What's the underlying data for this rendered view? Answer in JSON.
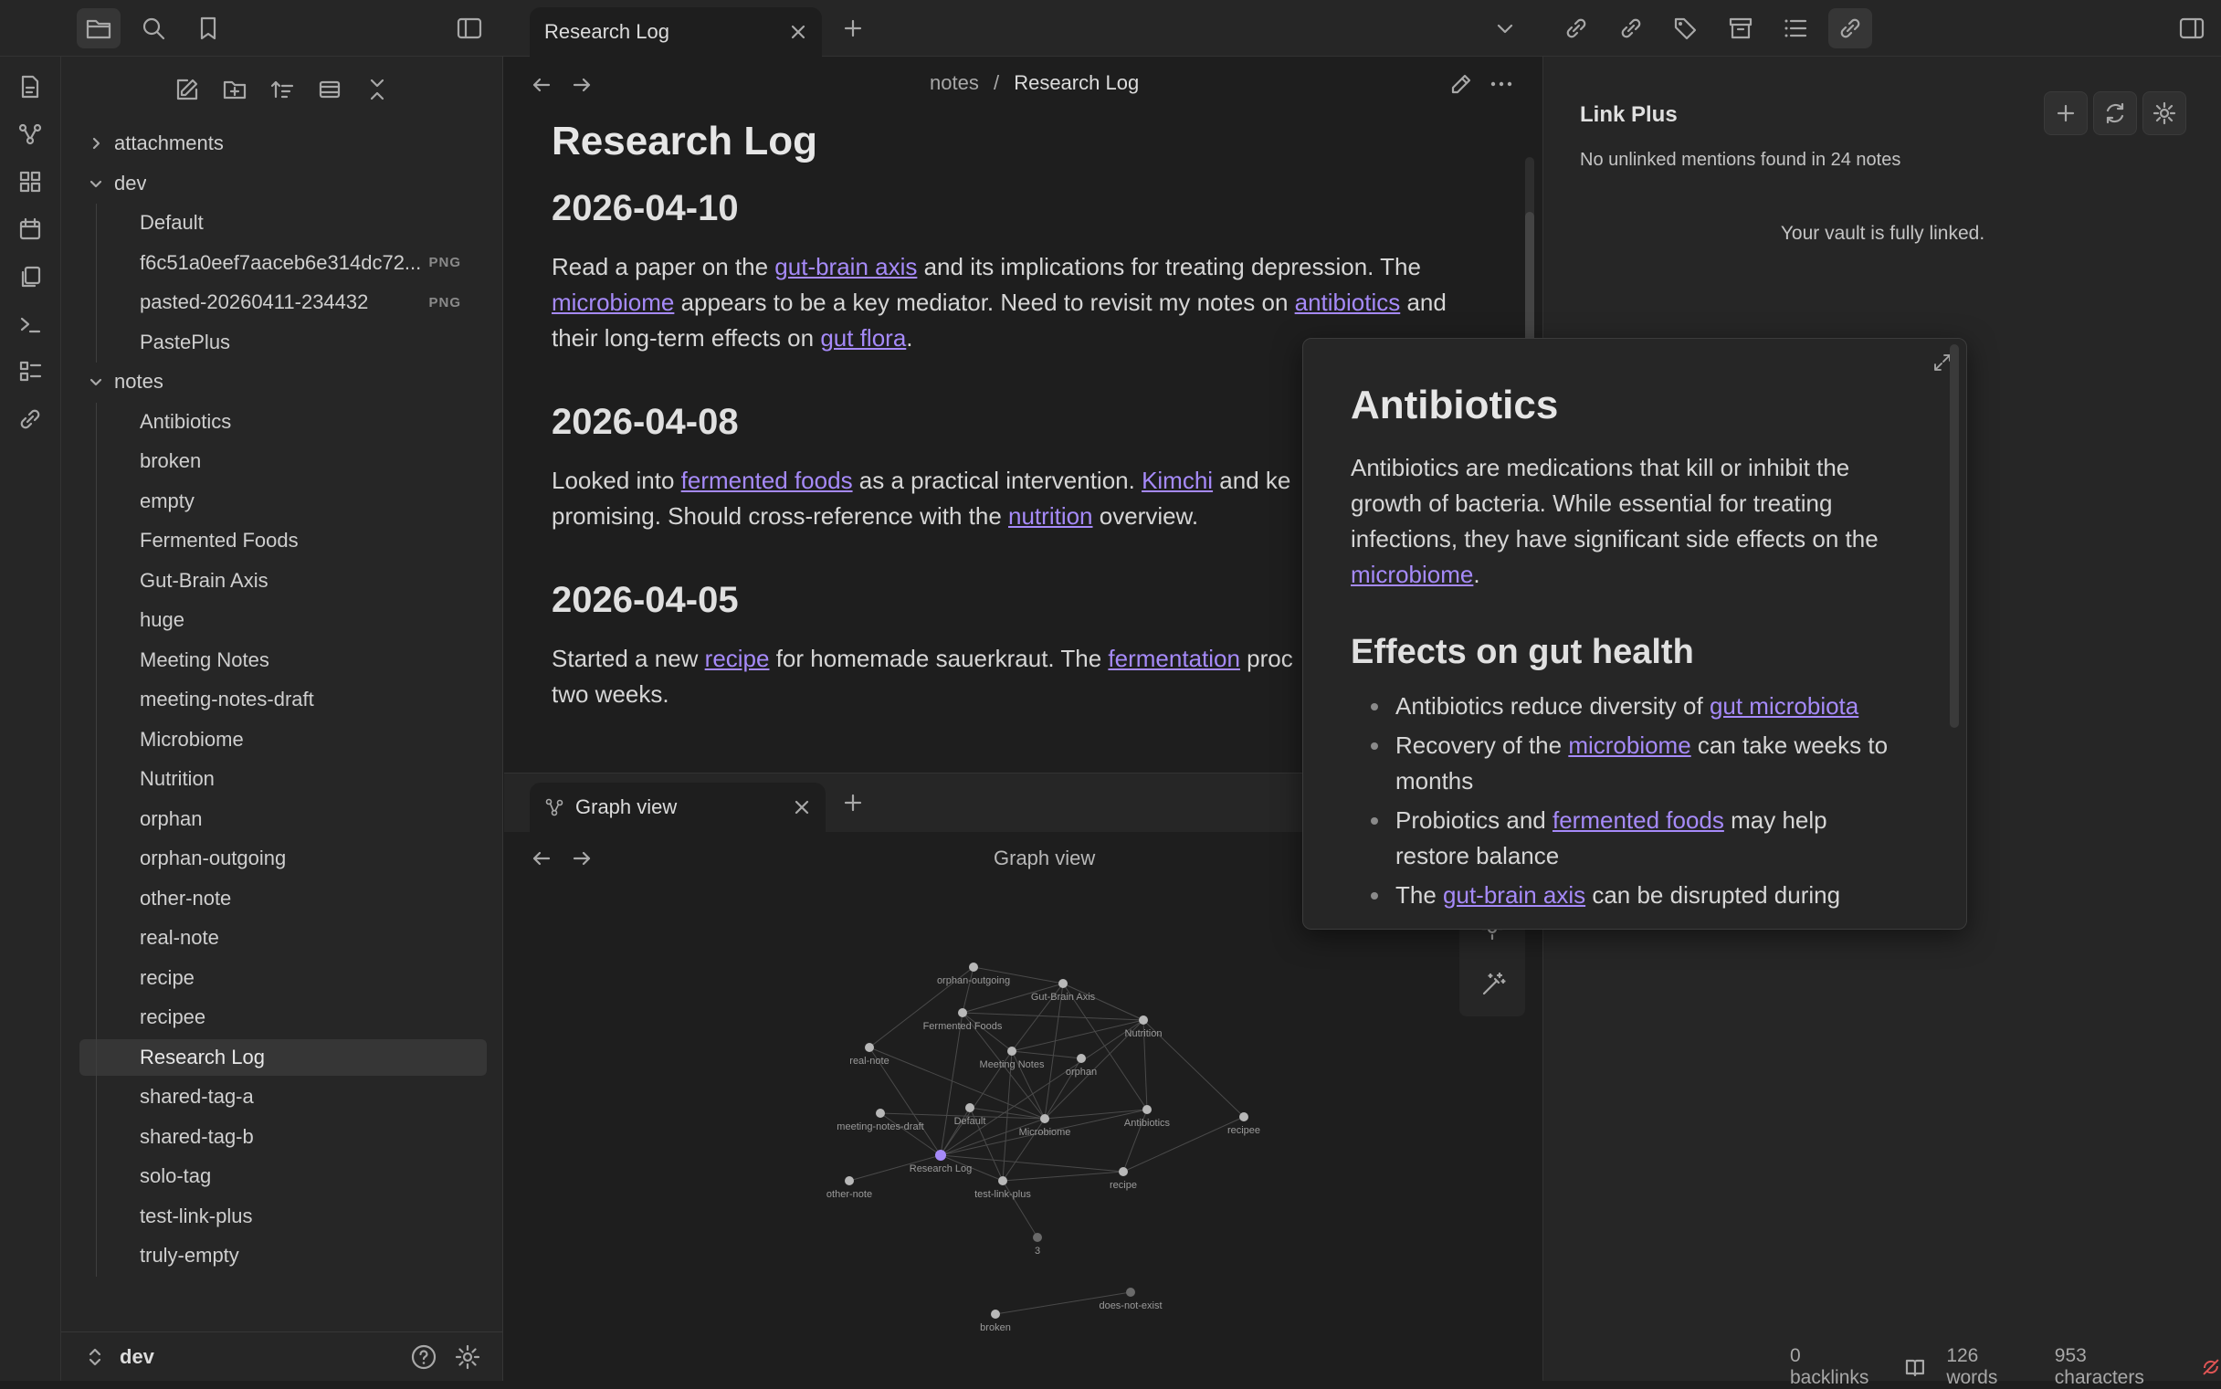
{
  "titlebar": {
    "active_tab": "Research Log",
    "colors": {
      "accent": "#a68af9",
      "bg": "#1e1e1e",
      "panel": "#262626"
    }
  },
  "sidebar": {
    "items": [
      {
        "label": "attachments",
        "kind": "folder",
        "expanded": false,
        "level": 0
      },
      {
        "label": "dev",
        "kind": "folder",
        "expanded": true,
        "level": 0
      },
      {
        "label": "Default",
        "kind": "file",
        "level": 1
      },
      {
        "label": "f6c51a0eef7aaceb6e314dc72...",
        "kind": "file",
        "level": 1,
        "badge": "PNG"
      },
      {
        "label": "pasted-20260411-234432",
        "kind": "file",
        "level": 1,
        "badge": "PNG"
      },
      {
        "label": "PastePlus",
        "kind": "file",
        "level": 1
      },
      {
        "label": "notes",
        "kind": "folder",
        "expanded": true,
        "level": 0
      },
      {
        "label": "Antibiotics",
        "kind": "file",
        "level": 1
      },
      {
        "label": "broken",
        "kind": "file",
        "level": 1
      },
      {
        "label": "empty",
        "kind": "file",
        "level": 1
      },
      {
        "label": "Fermented Foods",
        "kind": "file",
        "level": 1
      },
      {
        "label": "Gut-Brain Axis",
        "kind": "file",
        "level": 1
      },
      {
        "label": "huge",
        "kind": "file",
        "level": 1
      },
      {
        "label": "Meeting Notes",
        "kind": "file",
        "level": 1
      },
      {
        "label": "meeting-notes-draft",
        "kind": "file",
        "level": 1
      },
      {
        "label": "Microbiome",
        "kind": "file",
        "level": 1
      },
      {
        "label": "Nutrition",
        "kind": "file",
        "level": 1
      },
      {
        "label": "orphan",
        "kind": "file",
        "level": 1
      },
      {
        "label": "orphan-outgoing",
        "kind": "file",
        "level": 1
      },
      {
        "label": "other-note",
        "kind": "file",
        "level": 1
      },
      {
        "label": "real-note",
        "kind": "file",
        "level": 1
      },
      {
        "label": "recipe",
        "kind": "file",
        "level": 1
      },
      {
        "label": "recipee",
        "kind": "file",
        "level": 1
      },
      {
        "label": "Research Log",
        "kind": "file",
        "level": 1,
        "selected": true
      },
      {
        "label": "shared-tag-a",
        "kind": "file",
        "level": 1
      },
      {
        "label": "shared-tag-b",
        "kind": "file",
        "level": 1
      },
      {
        "label": "solo-tag",
        "kind": "file",
        "level": 1
      },
      {
        "label": "test-link-plus",
        "kind": "file",
        "level": 1
      },
      {
        "label": "truly-empty",
        "kind": "file",
        "level": 1
      }
    ],
    "vault_name": "dev"
  },
  "editor": {
    "breadcrumb_folder": "notes",
    "breadcrumb_sep": "/",
    "breadcrumb_file": "Research Log",
    "title": "Research Log",
    "sections": [
      {
        "heading": "2026-04-10",
        "line1": [
          {
            "t": "Read a paper on the "
          },
          {
            "l": "gut-brain axis"
          },
          {
            "t": " and its implications for treating depression. The"
          }
        ],
        "line2": [
          {
            "l": "microbiome"
          },
          {
            "t": " appears to be a key mediator. Need to revisit my notes on "
          },
          {
            "l": "antibiotics"
          },
          {
            "t": " and"
          }
        ],
        "line3": [
          {
            "t": "their long-term effects on "
          },
          {
            "l": "gut flora"
          },
          {
            "t": "."
          }
        ]
      },
      {
        "heading": "2026-04-08",
        "line1": [
          {
            "t": "Looked into "
          },
          {
            "l": "fermented foods"
          },
          {
            "t": " as a practical intervention. "
          },
          {
            "l": "Kimchi"
          },
          {
            "t": " and ke"
          }
        ],
        "line2": [
          {
            "t": "promising. Should cross-reference with the "
          },
          {
            "l": "nutrition"
          },
          {
            "t": " overview."
          }
        ]
      },
      {
        "heading": "2026-04-05",
        "line1": [
          {
            "t": "Started a new "
          },
          {
            "l": "recipe"
          },
          {
            "t": " for homemade sauerkraut. The "
          },
          {
            "l": "fermentation"
          },
          {
            "t": " proc"
          }
        ],
        "line2": [
          {
            "t": "two weeks."
          }
        ]
      }
    ]
  },
  "graph": {
    "tab_label": "Graph view",
    "header": "Graph view",
    "nodes": [
      {
        "label": "orphan-outgoing"
      },
      {
        "label": "Gut-Brain Axis"
      },
      {
        "label": "Fermented Foods"
      },
      {
        "label": "Nutrition"
      },
      {
        "label": "real-note"
      },
      {
        "label": "Meeting Notes"
      },
      {
        "label": "orphan"
      },
      {
        "label": "Default"
      },
      {
        "label": "meeting-notes-draft"
      },
      {
        "label": "Microbiome"
      },
      {
        "label": "Antibiotics"
      },
      {
        "label": "recipee"
      },
      {
        "label": "Research Log"
      },
      {
        "label": "test-link-plus"
      },
      {
        "label": "recipe"
      },
      {
        "label": "other-note"
      },
      {
        "label": "3"
      },
      {
        "label": "does-not-exist"
      },
      {
        "label": "broken"
      }
    ]
  },
  "rightpanel": {
    "title": "Link Plus",
    "status": "No unlinked mentions found in 24 notes",
    "message": "Your vault is fully linked."
  },
  "popover": {
    "title": "Antibiotics",
    "intro1": "Antibiotics are medications that kill or inhibit the",
    "intro2": "growth of bacteria. While essential for treating",
    "intro3": "infections, they have significant side effects on the",
    "intro_link": "microbiome",
    "intro_end": ".",
    "heading": "Effects on gut health",
    "bullets": [
      {
        "pre": "Antibiotics reduce diversity of ",
        "link": "gut microbiota",
        "post": ""
      },
      {
        "pre": "Recovery of the ",
        "link": "microbiome",
        "post": " can take weeks to"
      },
      {
        "pre": "months",
        "link": "",
        "post": ""
      },
      {
        "pre": "Probiotics and ",
        "link": "fermented foods",
        "post": " may help"
      },
      {
        "pre": "restore balance",
        "link": "",
        "post": ""
      },
      {
        "pre": "The ",
        "link": "gut-brain axis",
        "post": " can be disrupted during"
      }
    ]
  },
  "statusbar": {
    "backlinks": "0 backlinks",
    "words": "126 words",
    "chars": "953 characters"
  }
}
